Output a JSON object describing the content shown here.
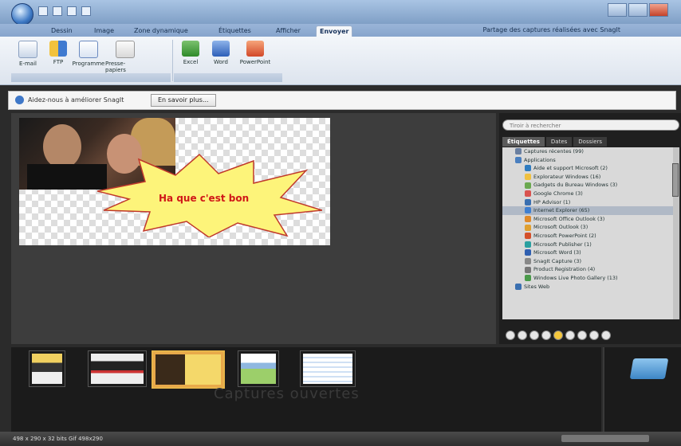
{
  "ribbon_tabs": [
    "Dessin",
    "Image",
    "Zone dynamique",
    "Étiquettes",
    "Afficher",
    "Envoyer"
  ],
  "active_tab_index": 5,
  "window_title": "",
  "tabs_right_text": "Partage des captures réalisées avec SnagIt",
  "ribbon": {
    "group1": {
      "buttons": [
        "E-mail",
        "FTP",
        "Programme",
        "Presse-papiers"
      ],
      "label": ""
    },
    "group2": {
      "buttons": [
        "Excel",
        "Word",
        "PowerPoint"
      ],
      "label": ""
    }
  },
  "infobar": {
    "text": "Aidez-nous à améliorer SnagIt",
    "button": "En savoir plus..."
  },
  "canvas": {
    "bubble_text": "Ha que c'est bon"
  },
  "sidepanel": {
    "search_placeholder": "Tiroir à rechercher",
    "tabs": [
      "Étiquettes",
      "Dates",
      "Dossiers"
    ],
    "tree": [
      "Captures récentes (99)",
      "Applications",
      "Aide et support Microsoft (2)",
      "Explorateur Windows (16)",
      "Gadgets du Bureau Windows (3)",
      "Google Chrome (3)",
      "HP Advisor (1)",
      "Internet Explorer (65)",
      "Microsoft Office Outlook (3)",
      "Microsoft Outlook (3)",
      "Microsoft PowerPoint (2)",
      "Microsoft Publisher (1)",
      "Microsoft Word (3)",
      "SnagIt Capture (3)",
      "Product Registration (4)",
      "Windows Live Photo Gallery (13)",
      "Sites Web"
    ],
    "selected_tree_index": 7,
    "tree_icon_colors": [
      "#6a7fa0",
      "#4a7fbf",
      "#2f7cc0",
      "#f0c040",
      "#6aa84f",
      "#d9534f",
      "#3a6fb0",
      "#3f7fd0",
      "#e08a2a",
      "#e0a030",
      "#d4502a",
      "#2aa0a0",
      "#2f5fb0",
      "#888888",
      "#777777",
      "#4a9a4a",
      "#3a6fb0"
    ]
  },
  "thumbbar": {
    "label": "Captures ouvertes"
  },
  "status": {
    "text": "498 x 290 x 32 bits  Gif 498x290"
  }
}
